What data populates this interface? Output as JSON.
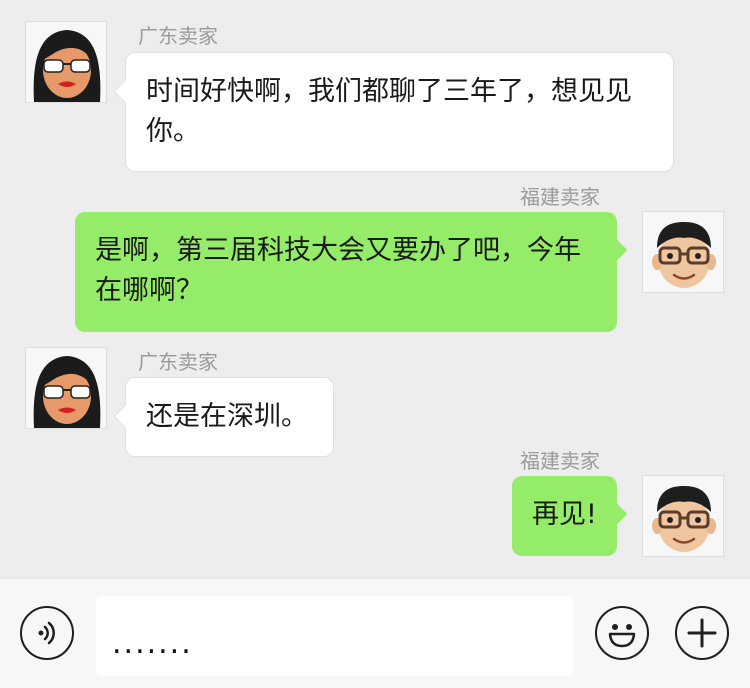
{
  "messages": [
    {
      "side": "left",
      "sender": "广东卖家",
      "avatar": "woman-sunglasses-avatar",
      "text": "时间好快啊，我们都聊了三年了，想见见你。"
    },
    {
      "side": "right",
      "sender": "福建卖家",
      "avatar": "man-glasses-avatar",
      "text": "是啊，第三届科技大会又要办了吧，今年在哪啊？"
    },
    {
      "side": "left",
      "sender": "广东卖家",
      "avatar": "woman-sunglasses-avatar",
      "text": "还是在深圳。"
    },
    {
      "side": "right",
      "sender": "福建卖家",
      "avatar": "man-glasses-avatar",
      "text": "再见!"
    }
  ],
  "input_bar": {
    "input_value": ".......",
    "voice_icon": "voice-icon",
    "emoji_icon": "emoji-icon",
    "add_icon": "plus-icon"
  },
  "colors": {
    "background": "#ededed",
    "left_bubble": "#ffffff",
    "right_bubble": "#95ec69",
    "sender_name": "#9b9b9b"
  }
}
